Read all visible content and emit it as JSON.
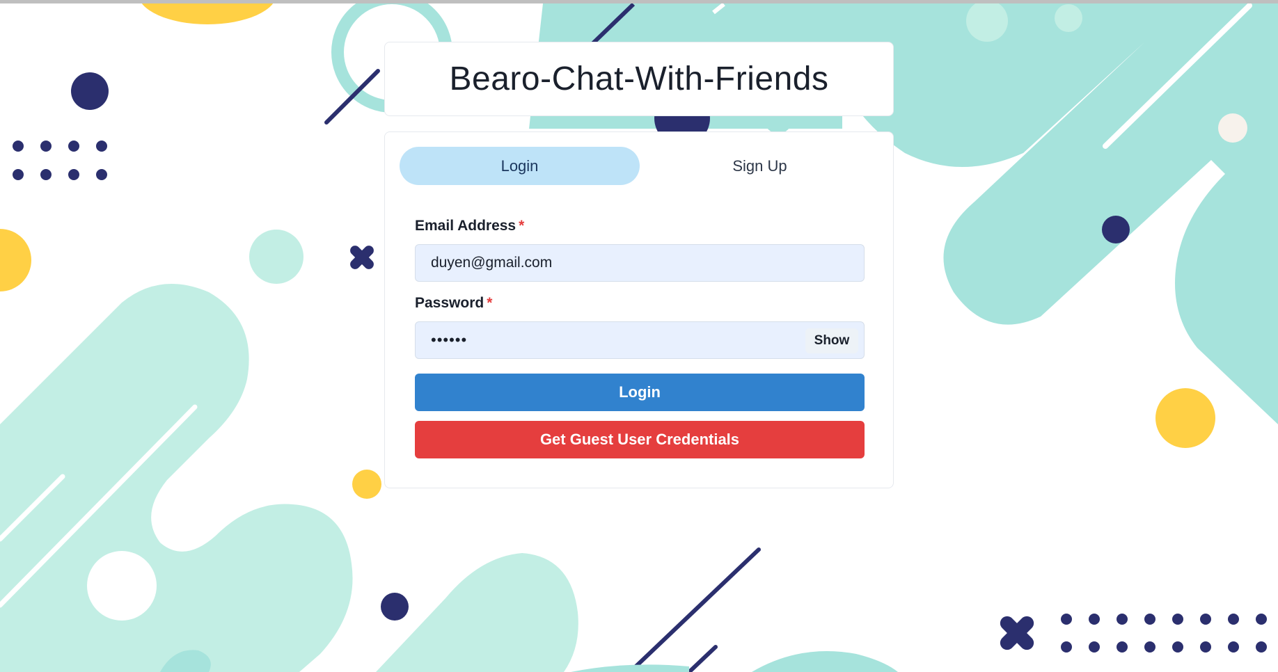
{
  "app": {
    "title": "Bearo-Chat-With-Friends"
  },
  "tabs": [
    {
      "label": "Login",
      "active": true
    },
    {
      "label": "Sign Up",
      "active": false
    }
  ],
  "form": {
    "email_label": "Email Address",
    "email_value": "duyen@gmail.com",
    "password_label": "Password",
    "password_masked": "••••••",
    "required_mark": "*",
    "show_label": "Show",
    "login_button": "Login",
    "guest_button": "Get Guest User Credentials"
  },
  "colors": {
    "navy": "#2b2f6e",
    "mint": "#a6e3dc",
    "mint_light": "#c2eee4",
    "yellow": "#ffd045",
    "tab_active": "#bee3f8",
    "primary": "#3182ce",
    "danger": "#e53e3e"
  }
}
